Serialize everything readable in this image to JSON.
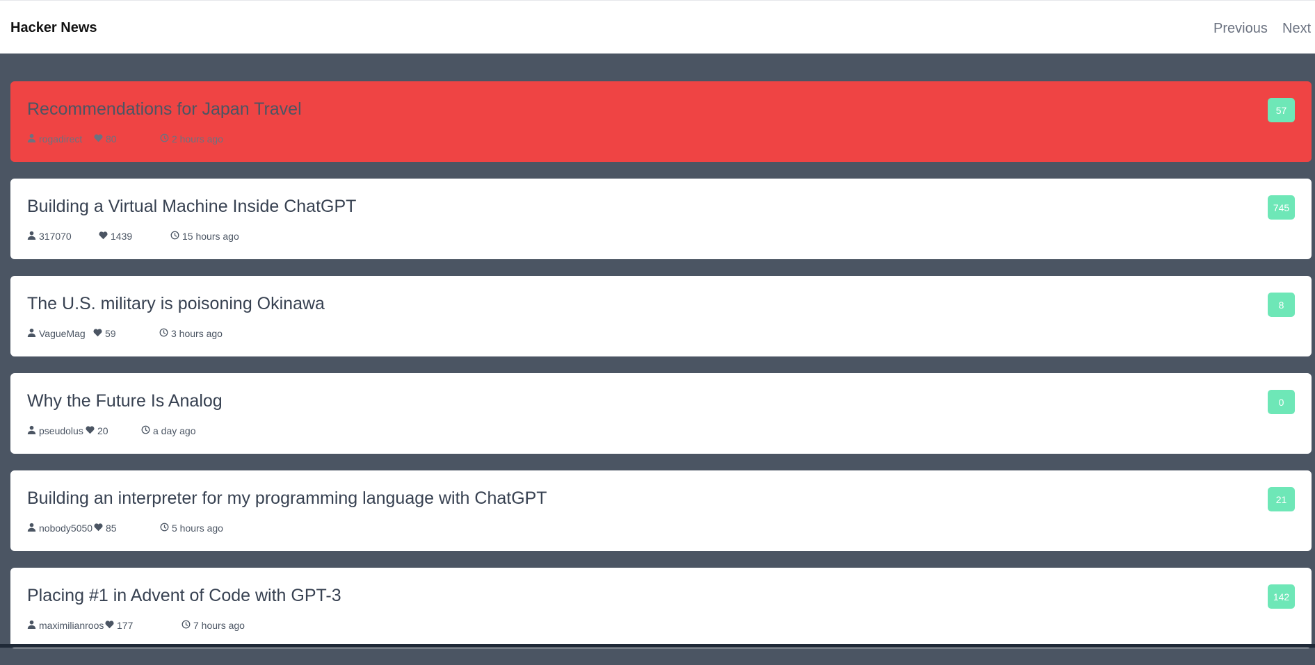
{
  "header": {
    "brand": "Hacker News",
    "previous_label": "Previous",
    "next_label": "Next"
  },
  "stories": [
    {
      "title": "Recommendations for Japan Travel",
      "author": "rogadirect",
      "points": "80",
      "time": "2 hours ago",
      "comments": "57",
      "active": true
    },
    {
      "title": "Building a Virtual Machine Inside ChatGPT",
      "author": "317070",
      "points": "1439",
      "time": "15 hours ago",
      "comments": "745",
      "active": false
    },
    {
      "title": "The U.S. military is poisoning Okinawa",
      "author": "VagueMag",
      "points": "59",
      "time": "3 hours ago",
      "comments": "8",
      "active": false
    },
    {
      "title": "Why the Future Is Analog",
      "author": "pseudolus",
      "points": "20",
      "time": "a day ago",
      "comments": "0",
      "active": false
    },
    {
      "title": "Building an interpreter for my programming language with ChatGPT",
      "author": "nobody5050",
      "points": "85",
      "time": "5 hours ago",
      "comments": "21",
      "active": false
    },
    {
      "title": "Placing #1 in Advent of Code with GPT-3",
      "author": "maximilianroos",
      "points": "177",
      "time": "7 hours ago",
      "comments": "142",
      "active": false
    }
  ],
  "colors": {
    "background": "#4b5563",
    "active_card": "#ef4444",
    "badge": "#6ee7b7"
  },
  "icons": [
    "user-icon",
    "heart-icon",
    "clock-icon"
  ]
}
